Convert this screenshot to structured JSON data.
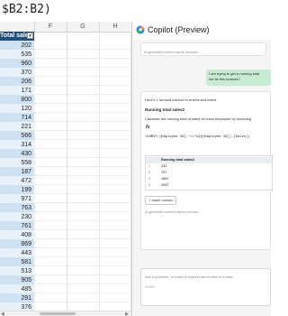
{
  "formula_bar": {
    "text": "$B2:B2)"
  },
  "sheet": {
    "columns": [
      "F",
      "G",
      "H"
    ],
    "table_header": "Total sales",
    "values": [
      "202",
      "535",
      "960",
      "370",
      "206",
      "171",
      "800",
      "120",
      "714",
      "221",
      "566",
      "314",
      "430",
      "558",
      "187",
      "472",
      "199",
      "971",
      "763",
      "230",
      "761",
      "408",
      "869",
      "443",
      "581",
      "513",
      "905",
      "485",
      "291",
      "376"
    ]
  },
  "copilot": {
    "title": "Copilot (Preview)",
    "ai_note_1": "AI-generated content may be incorrect",
    "user_message_line1": "I am trying to get a running total",
    "user_message_line2": "me fix this formula?",
    "reply_intro": "Here's 1 formula column to review and insert.",
    "column_name": "Running total sales2",
    "description": "Calculate the running total of sales for each employee by summing",
    "fx_label": "fx",
    "formula": "=SUMIF([Employee ID],\"<=\"&[@[Employee ID]],[Sales])",
    "preview_header": "Running total sales2",
    "preview_rows": [
      {
        "idx": "1",
        "value": "232"
      },
      {
        "idx": "2",
        "value": "757"
      },
      {
        "idx": "3",
        "value": "1687"
      },
      {
        "idx": "4",
        "value": "2067"
      }
    ],
    "insert_label": "Insert column",
    "ai_note_2": "AI-generated content may be incorrect",
    "prompt_placeholder": "Ask a question, or make a request about data in a table",
    "char_counter": "0/2000"
  },
  "colors": {
    "table_header": "#1f4e79",
    "band_dark": "#cfe2f3",
    "band_light": "#e8f1fa",
    "user_bubble": "#c8ecd3"
  }
}
